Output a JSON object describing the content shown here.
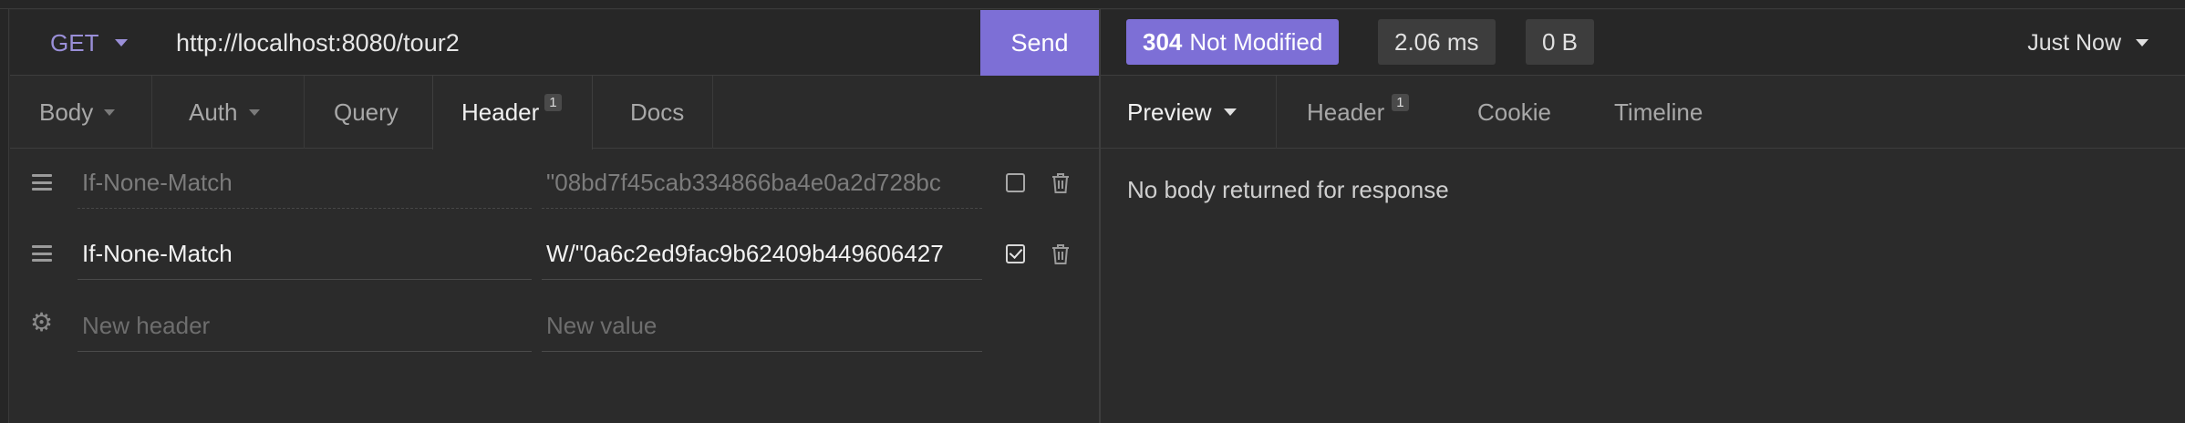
{
  "request": {
    "method": "GET",
    "url": "http://localhost:8080/tour2",
    "send_label": "Send"
  },
  "request_tabs": [
    {
      "label": "Body",
      "dropdown": true
    },
    {
      "label": "Auth",
      "dropdown": true
    },
    {
      "label": "Query"
    },
    {
      "label": "Header",
      "badge": "1",
      "active": true
    },
    {
      "label": "Docs"
    }
  ],
  "headers": [
    {
      "name": "If-None-Match",
      "value": "\"08bd7f45cab334866ba4e0a2d728bc",
      "enabled": false
    },
    {
      "name": "If-None-Match",
      "value": "W/\"0a6c2ed9fac9b62409b449606427",
      "enabled": true
    }
  ],
  "new_header": {
    "name_placeholder": "New header",
    "value_placeholder": "New value"
  },
  "response": {
    "status_code": "304",
    "status_text": "Not Modified",
    "time": "2.06 ms",
    "size": "0 B",
    "timestamp": "Just Now",
    "empty_message": "No body returned for response"
  },
  "response_tabs": [
    {
      "label": "Preview",
      "dropdown": true,
      "active": true
    },
    {
      "label": "Header",
      "badge": "1"
    },
    {
      "label": "Cookie"
    },
    {
      "label": "Timeline"
    }
  ],
  "colors": {
    "accent": "#7d6fd6",
    "background": "#2b2b2b"
  },
  "icons": [
    "chevron-down-icon",
    "drag-handle-icon",
    "gear-icon",
    "checkbox-icon",
    "trash-icon"
  ]
}
